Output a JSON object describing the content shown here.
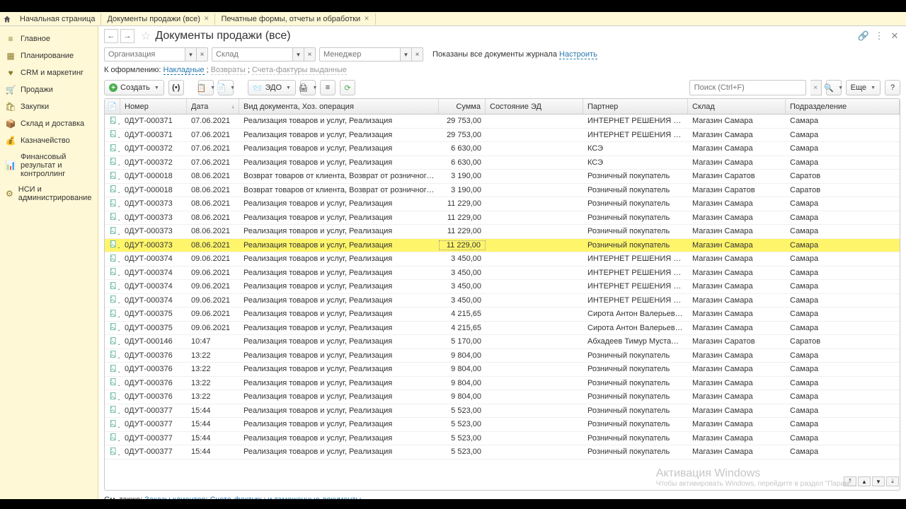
{
  "tabs": {
    "home": "Начальная страница",
    "t1": "Документы продажи (все)",
    "t2": "Печатные формы, отчеты и обработки"
  },
  "sidebar": [
    {
      "icon": "≡",
      "label": "Главное"
    },
    {
      "icon": "▦",
      "label": "Планирование"
    },
    {
      "icon": "♥",
      "label": "CRM и маркетинг"
    },
    {
      "icon": "🛒",
      "label": "Продажи"
    },
    {
      "icon": "🛍",
      "label": "Закупки"
    },
    {
      "icon": "📦",
      "label": "Склад и доставка"
    },
    {
      "icon": "💰",
      "label": "Казначейство"
    },
    {
      "icon": "📊",
      "label": "Финансовый результат и контроллинг"
    },
    {
      "icon": "⚙",
      "label": "НСИ и администрирование"
    }
  ],
  "page_title": "Документы продажи (все)",
  "filters": {
    "org_ph": "Организация",
    "sklad_ph": "Склад",
    "manager_ph": "Менеджер",
    "shown_text": "Показаны все документы журнала",
    "configure": "Настроить"
  },
  "design": {
    "label": "К оформлению:",
    "link1": "Накладные",
    "link2_disabled": "Возвраты",
    "link3_disabled": "Счета-фактуры выданные"
  },
  "toolbar": {
    "create": "Создать",
    "edo": "ЭДО",
    "more": "Еще",
    "search_ph": "Поиск (Ctrl+F)"
  },
  "columns": {
    "num": "Номер",
    "date": "Дата",
    "doc": "Вид документа, Хоз. операция",
    "sum": "Сумма",
    "ed": "Состояние ЭД",
    "partner": "Партнер",
    "sklad": "Склад",
    "podr": "Подразделение"
  },
  "rows": [
    {
      "num": "0ДУТ-000371",
      "date": "07.06.2021",
      "doc": "Реализация товаров и услуг, Реализация",
      "sum": "29 753,00",
      "partner": "ИНТЕРНЕТ РЕШЕНИЯ ООО",
      "sklad": "Магазин Самара",
      "podr": "Самара"
    },
    {
      "num": "0ДУТ-000371",
      "date": "07.06.2021",
      "doc": "Реализация товаров и услуг, Реализация",
      "sum": "29 753,00",
      "partner": "ИНТЕРНЕТ РЕШЕНИЯ ООО",
      "sklad": "Магазин Самара",
      "podr": "Самара"
    },
    {
      "num": "0ДУТ-000372",
      "date": "07.06.2021",
      "doc": "Реализация товаров и услуг, Реализация",
      "sum": "6 630,00",
      "partner": "КСЭ",
      "sklad": "Магазин Самара",
      "podr": "Самара"
    },
    {
      "num": "0ДУТ-000372",
      "date": "07.06.2021",
      "doc": "Реализация товаров и услуг, Реализация",
      "sum": "6 630,00",
      "partner": "КСЭ",
      "sklad": "Магазин Самара",
      "podr": "Самара"
    },
    {
      "num": "0ДУТ-000018",
      "date": "08.06.2021",
      "doc": "Возврат товаров от клиента, Возврат от розничного покупателя",
      "sum": "3 190,00",
      "partner": "Розничный покупатель",
      "sklad": "Магазин Саратов",
      "podr": "Саратов"
    },
    {
      "num": "0ДУТ-000018",
      "date": "08.06.2021",
      "doc": "Возврат товаров от клиента, Возврат от розничного покупателя",
      "sum": "3 190,00",
      "partner": "Розничный покупатель",
      "sklad": "Магазин Саратов",
      "podr": "Саратов"
    },
    {
      "num": "0ДУТ-000373",
      "date": "08.06.2021",
      "doc": "Реализация товаров и услуг, Реализация",
      "sum": "11 229,00",
      "partner": "Розничный покупатель",
      "sklad": "Магазин Самара",
      "podr": "Самара"
    },
    {
      "num": "0ДУТ-000373",
      "date": "08.06.2021",
      "doc": "Реализация товаров и услуг, Реализация",
      "sum": "11 229,00",
      "partner": "Розничный покупатель",
      "sklad": "Магазин Самара",
      "podr": "Самара"
    },
    {
      "num": "0ДУТ-000373",
      "date": "08.06.2021",
      "doc": "Реализация товаров и услуг, Реализация",
      "sum": "11 229,00",
      "partner": "Розничный покупатель",
      "sklad": "Магазин Самара",
      "podr": "Самара"
    },
    {
      "num": "0ДУТ-000373",
      "date": "08.06.2021",
      "doc": "Реализация товаров и услуг, Реализация",
      "sum": "11 229,00",
      "partner": "Розничный покупатель",
      "sklad": "Магазин Самара",
      "podr": "Самара",
      "selected": true
    },
    {
      "num": "0ДУТ-000374",
      "date": "09.06.2021",
      "doc": "Реализация товаров и услуг, Реализация",
      "sum": "3 450,00",
      "partner": "ИНТЕРНЕТ РЕШЕНИЯ ООО",
      "sklad": "Магазин Самара",
      "podr": "Самара"
    },
    {
      "num": "0ДУТ-000374",
      "date": "09.06.2021",
      "doc": "Реализация товаров и услуг, Реализация",
      "sum": "3 450,00",
      "partner": "ИНТЕРНЕТ РЕШЕНИЯ ООО",
      "sklad": "Магазин Самара",
      "podr": "Самара"
    },
    {
      "num": "0ДУТ-000374",
      "date": "09.06.2021",
      "doc": "Реализация товаров и услуг, Реализация",
      "sum": "3 450,00",
      "partner": "ИНТЕРНЕТ РЕШЕНИЯ ООО",
      "sklad": "Магазин Самара",
      "podr": "Самара"
    },
    {
      "num": "0ДУТ-000374",
      "date": "09.06.2021",
      "doc": "Реализация товаров и услуг, Реализация",
      "sum": "3 450,00",
      "partner": "ИНТЕРНЕТ РЕШЕНИЯ ООО",
      "sklad": "Магазин Самара",
      "podr": "Самара"
    },
    {
      "num": "0ДУТ-000375",
      "date": "09.06.2021",
      "doc": "Реализация товаров и услуг, Реализация",
      "sum": "4 215,65",
      "partner": "Сирота Антон Валерьевич ИП",
      "sklad": "Магазин Самара",
      "podr": "Самара"
    },
    {
      "num": "0ДУТ-000375",
      "date": "09.06.2021",
      "doc": "Реализация товаров и услуг, Реализация",
      "sum": "4 215,65",
      "partner": "Сирота Антон Валерьевич ИП",
      "sklad": "Магазин Самара",
      "podr": "Самара"
    },
    {
      "num": "0ДУТ-000146",
      "date": "10:47",
      "doc": "Реализация товаров и услуг, Реализация",
      "sum": "5 170,00",
      "partner": "Абхадеев Тимур Мустафович",
      "sklad": "Магазин Саратов",
      "podr": "Саратов"
    },
    {
      "num": "0ДУТ-000376",
      "date": "13:22",
      "doc": "Реализация товаров и услуг, Реализация",
      "sum": "9 804,00",
      "partner": "Розничный покупатель",
      "sklad": "Магазин Самара",
      "podr": "Самара"
    },
    {
      "num": "0ДУТ-000376",
      "date": "13:22",
      "doc": "Реализация товаров и услуг, Реализация",
      "sum": "9 804,00",
      "partner": "Розничный покупатель",
      "sklad": "Магазин Самара",
      "podr": "Самара"
    },
    {
      "num": "0ДУТ-000376",
      "date": "13:22",
      "doc": "Реализация товаров и услуг, Реализация",
      "sum": "9 804,00",
      "partner": "Розничный покупатель",
      "sklad": "Магазин Самара",
      "podr": "Самара"
    },
    {
      "num": "0ДУТ-000376",
      "date": "13:22",
      "doc": "Реализация товаров и услуг, Реализация",
      "sum": "9 804,00",
      "partner": "Розничный покупатель",
      "sklad": "Магазин Самара",
      "podr": "Самара"
    },
    {
      "num": "0ДУТ-000377",
      "date": "15:44",
      "doc": "Реализация товаров и услуг, Реализация",
      "sum": "5 523,00",
      "partner": "Розничный покупатель",
      "sklad": "Магазин Самара",
      "podr": "Самара"
    },
    {
      "num": "0ДУТ-000377",
      "date": "15:44",
      "doc": "Реализация товаров и услуг, Реализация",
      "sum": "5 523,00",
      "partner": "Розничный покупатель",
      "sklad": "Магазин Самара",
      "podr": "Самара"
    },
    {
      "num": "0ДУТ-000377",
      "date": "15:44",
      "doc": "Реализация товаров и услуг, Реализация",
      "sum": "5 523,00",
      "partner": "Розничный покупатель",
      "sklad": "Магазин Самара",
      "podr": "Самара"
    },
    {
      "num": "0ДУТ-000377",
      "date": "15:44",
      "doc": "Реализация товаров и услуг, Реализация",
      "sum": "5 523,00",
      "partner": "Розничный покупатель",
      "sklad": "Магазин Самара",
      "podr": "Самара"
    }
  ],
  "footer": {
    "label": "См. также:",
    "link1": "Заказы клиентов",
    "link2": "Счета-фактуры и таможенные документы"
  },
  "watermark": {
    "title": "Активация Windows",
    "sub": "Чтобы активировать Windows, перейдите в раздел \"Парам…"
  }
}
